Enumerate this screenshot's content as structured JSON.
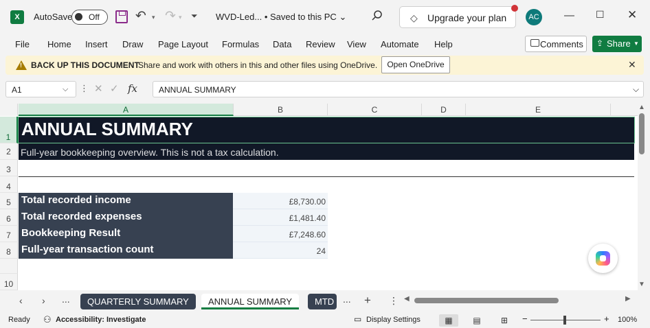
{
  "titlebar": {
    "app_icon": "X",
    "autosave_label": "AutoSave",
    "autosave_state": "Off",
    "file_name": "WVD-Led...",
    "save_status": "Saved to this PC",
    "upgrade_label": "Upgrade your plan",
    "avatar_initials": "AC"
  },
  "menu": {
    "items": [
      "File",
      "Home",
      "Insert",
      "Draw",
      "Page Layout",
      "Formulas",
      "Data",
      "Review",
      "View",
      "Automate",
      "Help"
    ],
    "comments_label": "Comments",
    "share_label": "Share"
  },
  "message_bar": {
    "title": "BACK UP THIS DOCUMENT",
    "body": "Share and work with others in this and other files using OneDrive.",
    "button_label": "Open OneDrive"
  },
  "formula_bar": {
    "name_box": "A1",
    "fx": "fx",
    "content": "ANNUAL SUMMARY"
  },
  "sheet": {
    "columns": [
      "A",
      "B",
      "C",
      "D",
      "E"
    ],
    "rows": [
      "1",
      "2",
      "3",
      "4",
      "5",
      "6",
      "7",
      "8",
      "10"
    ],
    "title": "ANNUAL SUMMARY",
    "subtitle": "Full-year bookkeeping overview. This is not a tax calculation.",
    "summary": [
      {
        "label": "Total recorded income",
        "value": "£8,730.00"
      },
      {
        "label": "Total recorded expenses",
        "value": "£1,481.40"
      },
      {
        "label": "Bookkeeping Result",
        "value": "£7,248.60"
      },
      {
        "label": "Full-year transaction count",
        "value": "24"
      }
    ],
    "colors": {
      "title_bg": "#111827",
      "label_bg": "#374151",
      "value_bg": "#f1f5f9",
      "accent": "#107c41"
    }
  },
  "tabs": {
    "sheets": [
      "QUARTERLY SUMMARY",
      "ANNUAL SUMMARY",
      "MTD"
    ],
    "active": "ANNUAL SUMMARY",
    "more": "...",
    "add": "+"
  },
  "status": {
    "ready": "Ready",
    "accessibility": "Accessibility: Investigate",
    "display_settings": "Display Settings",
    "zoom": "100%"
  }
}
